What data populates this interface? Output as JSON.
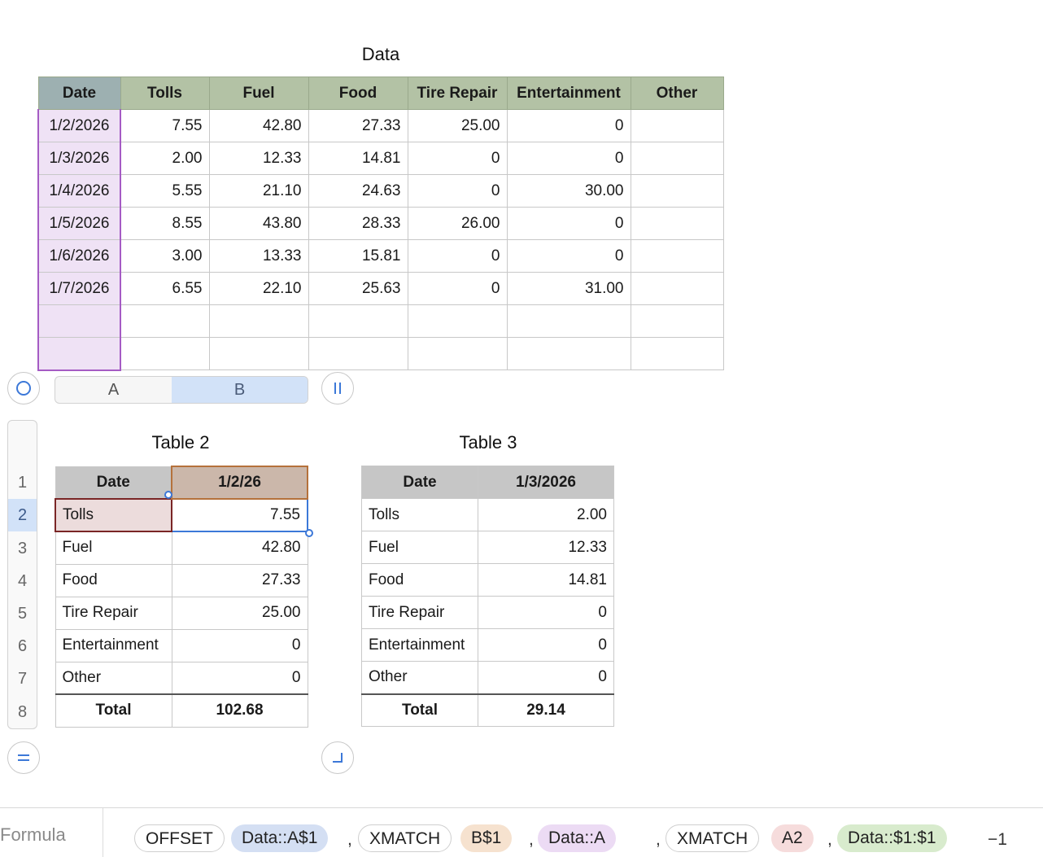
{
  "data_table": {
    "title": "Data",
    "headers": [
      "Date",
      "Tolls",
      "Fuel",
      "Food",
      "Tire Repair",
      "Entertainment",
      "Other"
    ],
    "rows": [
      [
        "1/2/2026",
        "7.55",
        "42.80",
        "27.33",
        "25.00",
        "0",
        ""
      ],
      [
        "1/3/2026",
        "2.00",
        "12.33",
        "14.81",
        "0",
        "0",
        ""
      ],
      [
        "1/4/2026",
        "5.55",
        "21.10",
        "24.63",
        "0",
        "30.00",
        ""
      ],
      [
        "1/5/2026",
        "8.55",
        "43.80",
        "28.33",
        "26.00",
        "0",
        ""
      ],
      [
        "1/6/2026",
        "3.00",
        "13.33",
        "15.81",
        "0",
        "0",
        ""
      ],
      [
        "1/7/2026",
        "6.55",
        "22.10",
        "25.63",
        "0",
        "31.00",
        ""
      ],
      [
        "",
        "",
        "",
        "",
        "",
        "",
        ""
      ],
      [
        "",
        "",
        "",
        "",
        "",
        "",
        ""
      ]
    ]
  },
  "column_bar": {
    "col_a": "A",
    "col_b": "B"
  },
  "row_numbers": [
    "1",
    "2",
    "3",
    "4",
    "5",
    "6",
    "7",
    "8"
  ],
  "table2": {
    "title": "Table 2",
    "header": [
      "Date",
      "1/2/26"
    ],
    "rows": [
      [
        "Tolls",
        "7.55"
      ],
      [
        "Fuel",
        "42.80"
      ],
      [
        "Food",
        "27.33"
      ],
      [
        "Tire Repair",
        "25.00"
      ],
      [
        "Entertainment",
        "0"
      ],
      [
        "Other",
        "0"
      ]
    ],
    "total": [
      "Total",
      "102.68"
    ]
  },
  "table3": {
    "title": "Table 3",
    "header": [
      "Date",
      "1/3/2026"
    ],
    "rows": [
      [
        "Tolls",
        "2.00"
      ],
      [
        "Fuel",
        "12.33"
      ],
      [
        "Food",
        "14.81"
      ],
      [
        "Tire Repair",
        "0"
      ],
      [
        "Entertainment",
        "0"
      ],
      [
        "Other",
        "0"
      ]
    ],
    "total": [
      "Total",
      "29.14"
    ]
  },
  "formula_bar": {
    "label": "Formula",
    "tokens": {
      "offset": "OFFSET",
      "ref1": "Data::A$1",
      "comma": ",",
      "xmatch1": "XMATCH",
      "ref2": "B$1",
      "ref3": "Data::A",
      "xmatch2": "XMATCH",
      "ref4": "A2",
      "ref5": "Data::$1:$1",
      "tail": "−1"
    }
  },
  "colors": {
    "data_header": "#b3c2a5",
    "date_column": "#efe2f5",
    "ref1_token": "#d4dff3",
    "ref2_token": "#f6e2cf",
    "ref3_token": "#ecdbf4",
    "ref4_token": "#f6dcdc",
    "ref5_token": "#d8ebcd",
    "selection": "#3c78d8"
  }
}
